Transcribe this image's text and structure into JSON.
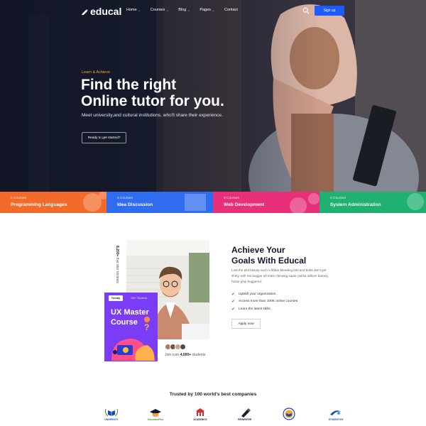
{
  "nav": {
    "logo": "educal",
    "menu": [
      {
        "label": "Home",
        "has_dropdown": true
      },
      {
        "label": "Courses",
        "has_dropdown": true
      },
      {
        "label": "Blog",
        "has_dropdown": true
      },
      {
        "label": "Pages",
        "has_dropdown": true
      },
      {
        "label": "Contact",
        "has_dropdown": false
      }
    ],
    "search_icon": "search-icon",
    "signup_label": "Sign up",
    "accent": "#1e5bff"
  },
  "hero": {
    "eyebrow": "Learn & Achieve",
    "title_line1": "Find the right",
    "title_line2": "Online tutor for you.",
    "subtitle": "Meet university,and cultural institutions, who'll share their experience.",
    "cta_label": "Ready to get started?",
    "eyebrow_color": "#f2a23a"
  },
  "categories": [
    {
      "count": "6 Courses",
      "name": "Programming Languages",
      "color": "#f26b2a"
    },
    {
      "count": "4 Courses",
      "name": "Idea Discussion",
      "color": "#2f6cf0"
    },
    {
      "count": "8 Courses",
      "name": "Web Development",
      "color": "#e8307a"
    },
    {
      "count": "6 Courses",
      "name": "System Administration",
      "color": "#20b072"
    }
  ],
  "achieve": {
    "stat_number": "8,200+",
    "stat_text": "five star reviews",
    "card_badge": "Trendy",
    "card_students": "185+ Students",
    "card_title": "UX Master Course",
    "join_prefix": "Join over",
    "join_number": "4,000+",
    "join_suffix": "students",
    "title_line1": "Achieve Your",
    "title_line2": "Goals With Educal",
    "description": "Lost the plot bloody such a fibber bleeding bits and bobs don't get shirty with me bugger all mate chinwag super pukka william barney, horse play buggered.",
    "checklist": [
      "Upskill your organization.",
      "Access more than 100K online courses",
      "Learn the latest skills"
    ],
    "apply_label": "Apply now",
    "card_color": "#7a3cf5"
  },
  "trusted": {
    "heading": "Trusted by 100 world's best companies",
    "brands": [
      {
        "name": "UNIVERSITY",
        "icon": "book-laurel-icon"
      },
      {
        "name": "EducationPlus",
        "icon": "graduation-cap-icon"
      },
      {
        "name": "ACADEMICS",
        "icon": "academic-building-icon"
      },
      {
        "name": "PENWRITER",
        "icon": "pen-nib-icon"
      },
      {
        "name": "",
        "icon": "seal-book-icon"
      },
      {
        "name": "STUDENTICH",
        "icon": "student-swoosh-icon"
      }
    ]
  }
}
